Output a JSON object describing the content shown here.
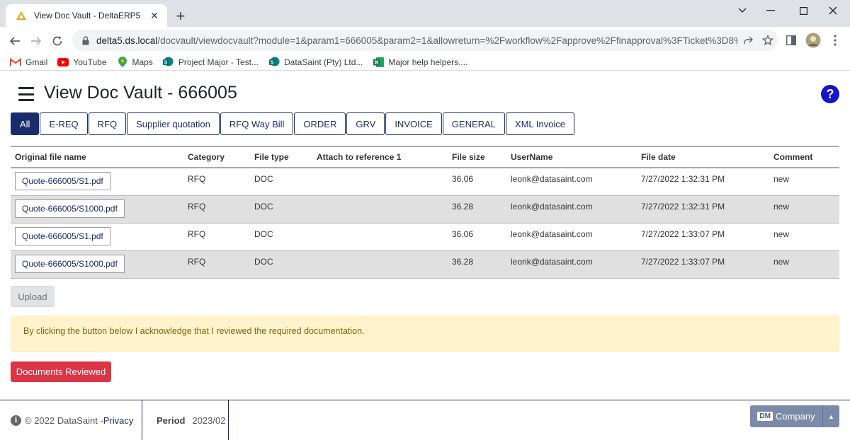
{
  "browser": {
    "tab_title": "View Doc Vault - DeltaERP5",
    "url_host": "delta5.ds.local",
    "url_path": "/docvault/viewdocvault?module=1&param1=666005&param2=1&allowreturn=%2Fworkflow%2Fapprove%2Ffinapproval%3FTicket%3D8%...",
    "bookmarks": [
      {
        "label": "Gmail",
        "icon": "gmail-icon",
        "color": "#ea4335"
      },
      {
        "label": "YouTube",
        "icon": "youtube-icon",
        "color": "#ff0000"
      },
      {
        "label": "Maps",
        "icon": "maps-icon",
        "color": "#34a853"
      },
      {
        "label": "Project Major - Test...",
        "icon": "sharepoint-icon",
        "color": "#038387"
      },
      {
        "label": "DataSaint (Pty) Ltd...",
        "icon": "sharepoint-icon",
        "color": "#038387"
      },
      {
        "label": "Major help helpers....",
        "icon": "excel-icon",
        "color": "#1d6f42"
      }
    ]
  },
  "page": {
    "title": "View Doc Vault - 666005",
    "help_label": "?"
  },
  "filter_tabs": [
    "All",
    "E-REQ",
    "RFQ",
    "Supplier quotation",
    "RFQ Way Bill",
    "ORDER",
    "GRV",
    "INVOICE",
    "GENERAL",
    "XML Invoice"
  ],
  "active_tab": "All",
  "table": {
    "headers": [
      "Original file name",
      "Category",
      "File type",
      "Attach to reference 1",
      "File size",
      "UserName",
      "File date",
      "Comment"
    ],
    "rows": [
      {
        "file": "Quote-666005/S1.pdf",
        "category": "RFQ",
        "type": "DOC",
        "ref": "",
        "size": "36.06",
        "user": "leonk@datasaint.com",
        "date": "7/27/2022 1:32:31 PM",
        "comment": "new"
      },
      {
        "file": "Quote-666005/S1000.pdf",
        "category": "RFQ",
        "type": "DOC",
        "ref": "",
        "size": "36.28",
        "user": "leonk@datasaint.com",
        "date": "7/27/2022 1:32:31 PM",
        "comment": "new"
      },
      {
        "file": "Quote-666005/S1.pdf",
        "category": "RFQ",
        "type": "DOC",
        "ref": "",
        "size": "36.06",
        "user": "leonk@datasaint.com",
        "date": "7/27/2022 1:33:07 PM",
        "comment": "new"
      },
      {
        "file": "Quote-666005/S1000.pdf",
        "category": "RFQ",
        "type": "DOC",
        "ref": "",
        "size": "36.28",
        "user": "leonk@datasaint.com",
        "date": "7/27/2022 1:33:07 PM",
        "comment": "new"
      }
    ]
  },
  "actions": {
    "upload_label": "Upload",
    "notice_text": "By clicking the button below I acknowledge that I reviewed the required documentation.",
    "reviewed_label": "Documents Reviewed"
  },
  "footer": {
    "copyright": "© 2022 DataSaint - ",
    "privacy_label": "Privacy",
    "period_label": "Period",
    "period_value": "2023/02",
    "company_badge": "DM",
    "company_label": "Company"
  },
  "colors": {
    "brand_navy": "#1a2d6b",
    "danger": "#dc3545",
    "notice_bg": "#fff3cd",
    "help_blue": "#1414c8"
  }
}
